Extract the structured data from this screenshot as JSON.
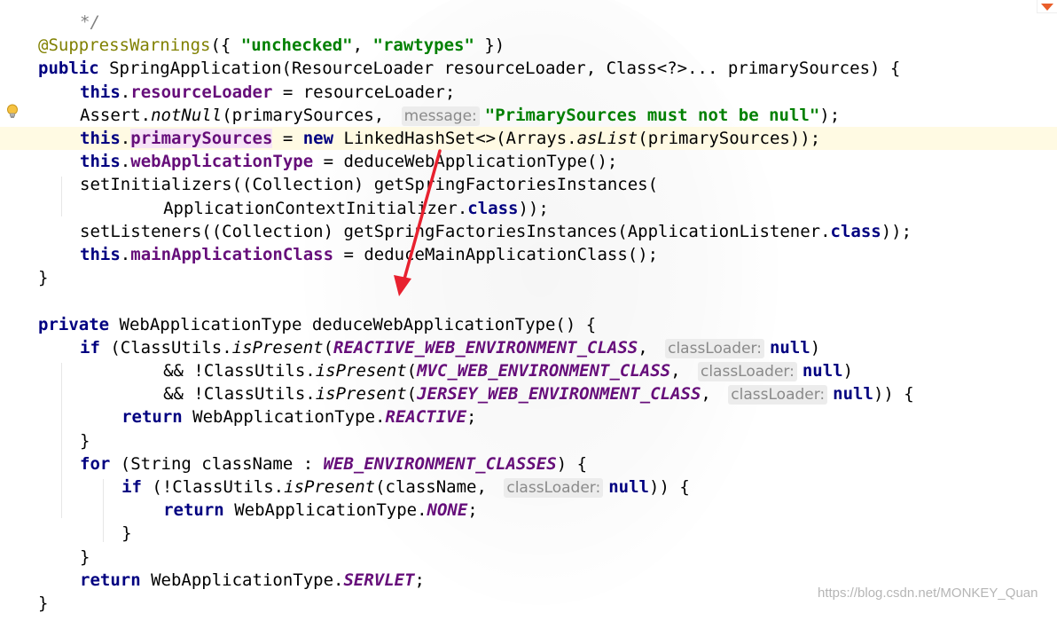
{
  "editor": {
    "lines": [
      {
        "indent": 4,
        "tokens": [
          {
            "t": "*/",
            "c": "comment"
          }
        ]
      },
      {
        "indent": 0,
        "tokens": [
          {
            "t": "@SuppressWarnings",
            "c": "anno"
          },
          {
            "t": "({ "
          },
          {
            "t": "\"unchecked\"",
            "c": "str"
          },
          {
            "t": ", "
          },
          {
            "t": "\"rawtypes\"",
            "c": "str"
          },
          {
            "t": " })"
          }
        ]
      },
      {
        "indent": 0,
        "tokens": [
          {
            "t": "public",
            "c": "kw"
          },
          {
            "t": " SpringApplication(ResourceLoader resourceLoader, Class<?>... primarySources) {"
          }
        ]
      },
      {
        "indent": 4,
        "tokens": [
          {
            "t": "this",
            "c": "kw"
          },
          {
            "t": "."
          },
          {
            "t": "resourceLoader",
            "c": "field"
          },
          {
            "t": " = resourceLoader;"
          }
        ]
      },
      {
        "indent": 4,
        "tokens": [
          {
            "t": "Assert."
          },
          {
            "t": "notNull",
            "c": "method-i"
          },
          {
            "t": "(primarySources, "
          },
          {
            "t": "message:",
            "c": "hint"
          },
          {
            "t": "\"PrimarySources must not be null\"",
            "c": "str"
          },
          {
            "t": ");"
          }
        ]
      },
      {
        "indent": 4,
        "current": true,
        "tokens": [
          {
            "t": "this",
            "c": "kw"
          },
          {
            "t": "."
          },
          {
            "t": "primarySources",
            "c": "field hl-pink"
          },
          {
            "t": " = "
          },
          {
            "t": "new",
            "c": "kw"
          },
          {
            "t": " LinkedHashSet<>(Arrays."
          },
          {
            "t": "asList",
            "c": "method-i"
          },
          {
            "t": "(primarySources));"
          }
        ]
      },
      {
        "indent": 4,
        "tokens": [
          {
            "t": "this",
            "c": "kw"
          },
          {
            "t": "."
          },
          {
            "t": "webApplicationType",
            "c": "field"
          },
          {
            "t": " = deduceWebApplicationType();"
          }
        ]
      },
      {
        "indent": 4,
        "tokens": [
          {
            "t": "setInitializers((Collection) getSpringFactoriesInstances("
          }
        ]
      },
      {
        "indent": 12,
        "tokens": [
          {
            "t": "ApplicationContextInitializer."
          },
          {
            "t": "class",
            "c": "kw"
          },
          {
            "t": "));"
          }
        ]
      },
      {
        "indent": 4,
        "tokens": [
          {
            "t": "setListeners((Collection) getSpringFactoriesInstances(ApplicationListener."
          },
          {
            "t": "class",
            "c": "kw"
          },
          {
            "t": "));"
          }
        ]
      },
      {
        "indent": 4,
        "tokens": [
          {
            "t": "this",
            "c": "kw"
          },
          {
            "t": "."
          },
          {
            "t": "mainApplicationClass",
            "c": "field"
          },
          {
            "t": " = deduceMainApplicationClass();"
          }
        ]
      },
      {
        "indent": 0,
        "tokens": [
          {
            "t": "}"
          }
        ]
      },
      {
        "indent": 0,
        "tokens": []
      },
      {
        "indent": 0,
        "tokens": [
          {
            "t": "private",
            "c": "kw"
          },
          {
            "t": " WebApplicationType deduceWebApplicationType() {"
          }
        ]
      },
      {
        "indent": 4,
        "tokens": [
          {
            "t": "if",
            "c": "kw"
          },
          {
            "t": " (ClassUtils."
          },
          {
            "t": "isPresent",
            "c": "method-i"
          },
          {
            "t": "("
          },
          {
            "t": "REACTIVE_WEB_ENVIRONMENT_CLASS",
            "c": "static"
          },
          {
            "t": ", "
          },
          {
            "t": "classLoader:",
            "c": "hint"
          },
          {
            "t": "null",
            "c": "kw"
          },
          {
            "t": ")"
          }
        ]
      },
      {
        "indent": 12,
        "tokens": [
          {
            "t": "&& !ClassUtils."
          },
          {
            "t": "isPresent",
            "c": "method-i"
          },
          {
            "t": "("
          },
          {
            "t": "MVC_WEB_ENVIRONMENT_CLASS",
            "c": "static"
          },
          {
            "t": ", "
          },
          {
            "t": "classLoader:",
            "c": "hint"
          },
          {
            "t": "null",
            "c": "kw"
          },
          {
            "t": ")"
          }
        ]
      },
      {
        "indent": 12,
        "tokens": [
          {
            "t": "&& !ClassUtils."
          },
          {
            "t": "isPresent",
            "c": "method-i"
          },
          {
            "t": "("
          },
          {
            "t": "JERSEY_WEB_ENVIRONMENT_CLASS",
            "c": "static"
          },
          {
            "t": ", "
          },
          {
            "t": "classLoader:",
            "c": "hint"
          },
          {
            "t": "null",
            "c": "kw"
          },
          {
            "t": ")) {"
          }
        ]
      },
      {
        "indent": 8,
        "tokens": [
          {
            "t": "return",
            "c": "kw"
          },
          {
            "t": " WebApplicationType."
          },
          {
            "t": "REACTIVE",
            "c": "static"
          },
          {
            "t": ";"
          }
        ]
      },
      {
        "indent": 4,
        "tokens": [
          {
            "t": "}"
          }
        ]
      },
      {
        "indent": 4,
        "tokens": [
          {
            "t": "for",
            "c": "kw"
          },
          {
            "t": " (String className : "
          },
          {
            "t": "WEB_ENVIRONMENT_CLASSES",
            "c": "static"
          },
          {
            "t": ") {"
          }
        ]
      },
      {
        "indent": 8,
        "tokens": [
          {
            "t": "if",
            "c": "kw"
          },
          {
            "t": " (!ClassUtils."
          },
          {
            "t": "isPresent",
            "c": "method-i"
          },
          {
            "t": "(className, "
          },
          {
            "t": "classLoader:",
            "c": "hint"
          },
          {
            "t": "null",
            "c": "kw"
          },
          {
            "t": ")) {"
          }
        ]
      },
      {
        "indent": 12,
        "tokens": [
          {
            "t": "return",
            "c": "kw"
          },
          {
            "t": " WebApplicationType."
          },
          {
            "t": "NONE",
            "c": "static"
          },
          {
            "t": ";"
          }
        ]
      },
      {
        "indent": 8,
        "tokens": [
          {
            "t": "}"
          }
        ]
      },
      {
        "indent": 4,
        "tokens": [
          {
            "t": "}"
          }
        ]
      },
      {
        "indent": 4,
        "tokens": [
          {
            "t": "return",
            "c": "kw"
          },
          {
            "t": " WebApplicationType."
          },
          {
            "t": "SERVLET",
            "c": "static"
          },
          {
            "t": ";"
          }
        ]
      },
      {
        "indent": 0,
        "tokens": [
          {
            "t": "}"
          }
        ]
      }
    ]
  },
  "gutter": {
    "icon": "lightbulb-icon"
  },
  "annotation": {
    "icon": "red-arrow-icon",
    "color": "#e8212f"
  },
  "watermark": {
    "text": "https://blog.csdn.net/MONKEY_Quan"
  }
}
